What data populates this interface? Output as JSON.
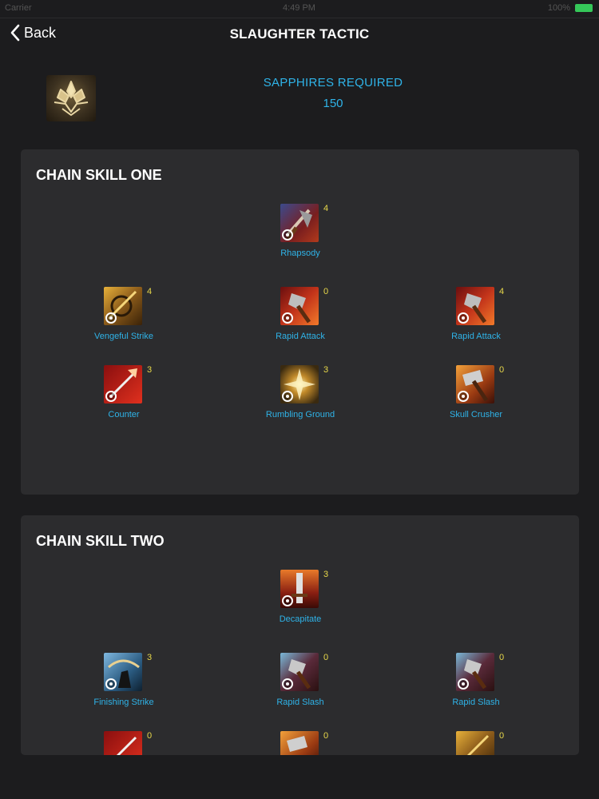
{
  "status": {
    "carrier": "Carrier",
    "time": "4:49 PM",
    "battery": "100%"
  },
  "nav": {
    "back_label": "Back",
    "title": "SLAUGHTER TACTIC"
  },
  "header": {
    "sapphires_label": "SAPPHIRES REQUIRED",
    "sapphires_value": "150"
  },
  "chain_one": {
    "title": "CHAIN SKILL ONE",
    "skills": [
      {
        "name": "Rhapsody",
        "level": "4"
      },
      {
        "name": "Vengeful Strike",
        "level": "4"
      },
      {
        "name": "Rapid Attack",
        "level": "0"
      },
      {
        "name": "Rapid Attack",
        "level": "4"
      },
      {
        "name": "Counter",
        "level": "3"
      },
      {
        "name": "Rumbling Ground",
        "level": "3"
      },
      {
        "name": "Skull Crusher",
        "level": "0"
      }
    ]
  },
  "chain_two": {
    "title": "CHAIN SKILL TWO",
    "skills": [
      {
        "name": "Decapitate",
        "level": "3"
      },
      {
        "name": "Finishing Strike",
        "level": "3"
      },
      {
        "name": "Rapid Slash",
        "level": "0"
      },
      {
        "name": "Rapid Slash",
        "level": "0"
      },
      {
        "name": "",
        "level": "0"
      },
      {
        "name": "",
        "level": "0"
      },
      {
        "name": "",
        "level": "0"
      }
    ]
  },
  "colors": {
    "accent": "#2fb3e8",
    "level": "#e8d84a",
    "card": "#2c2c2e",
    "background": "#1c1c1e"
  }
}
